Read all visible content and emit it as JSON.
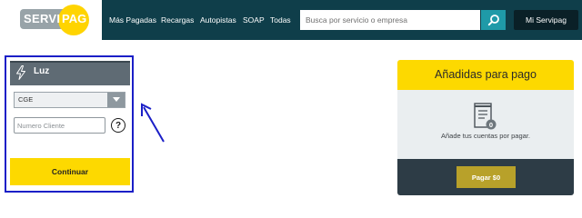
{
  "header": {
    "logo": {
      "left": "SERVI",
      "right": "PAG"
    },
    "nav_items": [
      "Más Pagadas",
      "Recargas",
      "Autopistas",
      "SOAP",
      "Todas"
    ],
    "search_placeholder": "Busca por servicio o empresa",
    "account_button": "Mi Servipag"
  },
  "service_form": {
    "title": "Luz",
    "icon": "lightning-bolt-icon",
    "company_select": {
      "selected": "CGE"
    },
    "client_input": {
      "placeholder": "Numero Cliente",
      "value": ""
    },
    "help_label": "?",
    "submit_label": "Continuar"
  },
  "cart": {
    "title": "Añadidas para pago",
    "icon": "receipt-icon",
    "badge": "0",
    "empty_message": "Añade tus cuentas por pagar.",
    "pay_button": "Pagar $0"
  },
  "colors": {
    "header_bg": "#0f3e4a",
    "accent_yellow": "#fdd900",
    "search_button": "#1f9aa8",
    "annotation_blue": "#1b1fc7"
  }
}
